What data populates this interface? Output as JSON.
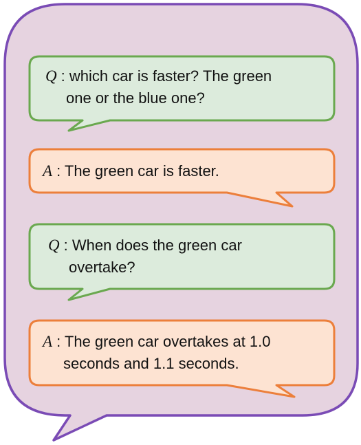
{
  "colors": {
    "outer_fill": "#e6d3e0",
    "outer_stroke": "#7a4bb5",
    "question_fill": "#dcebdc",
    "question_stroke": "#6aa84f",
    "answer_fill": "#fde3d2",
    "answer_stroke": "#ec7f3b"
  },
  "dialogue": [
    {
      "speaker": "Q",
      "sep": ":",
      "line1": "which car is faster? The green",
      "line2": "one or the blue one?"
    },
    {
      "speaker": "A",
      "sep": ":",
      "line1": "The green car is faster.",
      "line2": ""
    },
    {
      "speaker": "Q",
      "sep": ":",
      "line1": "When does the green car",
      "line2": "overtake?"
    },
    {
      "speaker": "A",
      "sep": ":",
      "line1": "The green car overtakes at 1.0",
      "line2": "seconds and 1.1 seconds."
    }
  ]
}
